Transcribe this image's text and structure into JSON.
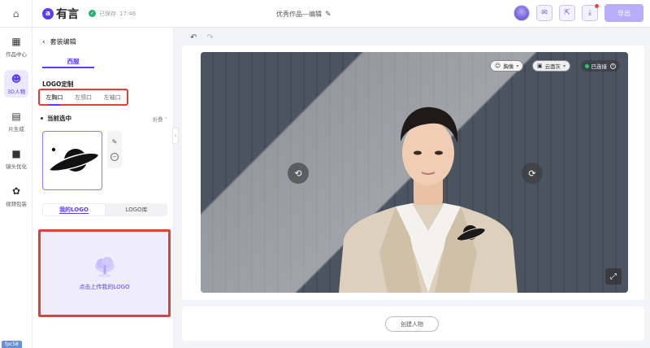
{
  "topbar": {
    "brand": "有言",
    "brand_mark": "a",
    "saved_status": "已保存",
    "saved_time": "17:46",
    "doc_title": "优秀作品—编辑",
    "export_label": "导出"
  },
  "leftnav": {
    "items": [
      {
        "label": "作品中心",
        "icon": "grid-icon"
      },
      {
        "label": "3D人物",
        "icon": "robot-icon"
      },
      {
        "label": "片生成",
        "icon": "chart-icon"
      },
      {
        "label": "镜头优化",
        "icon": "camera-icon"
      },
      {
        "label": "视频包装",
        "icon": "palette-icon"
      }
    ],
    "version": "fpc58"
  },
  "panel": {
    "title": "套装编辑",
    "category_tab": "西服",
    "logo_section_title": "LOGO定制",
    "positions": [
      "左胸口",
      "左领口",
      "左袖口"
    ],
    "active_position": "左胸口",
    "current_selected": "当前选中",
    "fold_label": "折叠",
    "logo_tabs": [
      "我的LOGO",
      "LOGO库"
    ],
    "active_logo_tab": "我的LOGO",
    "upload_label": "点击上传我的LOGO"
  },
  "stage": {
    "pose_label": "胸像",
    "background_label": "云面灰",
    "connection_status": "已连接"
  },
  "bottom": {
    "create_label": "创建人物"
  },
  "colors": {
    "accent": "#5b3df5",
    "highlight_border": "#e0403a",
    "connected": "#2fc56b"
  }
}
